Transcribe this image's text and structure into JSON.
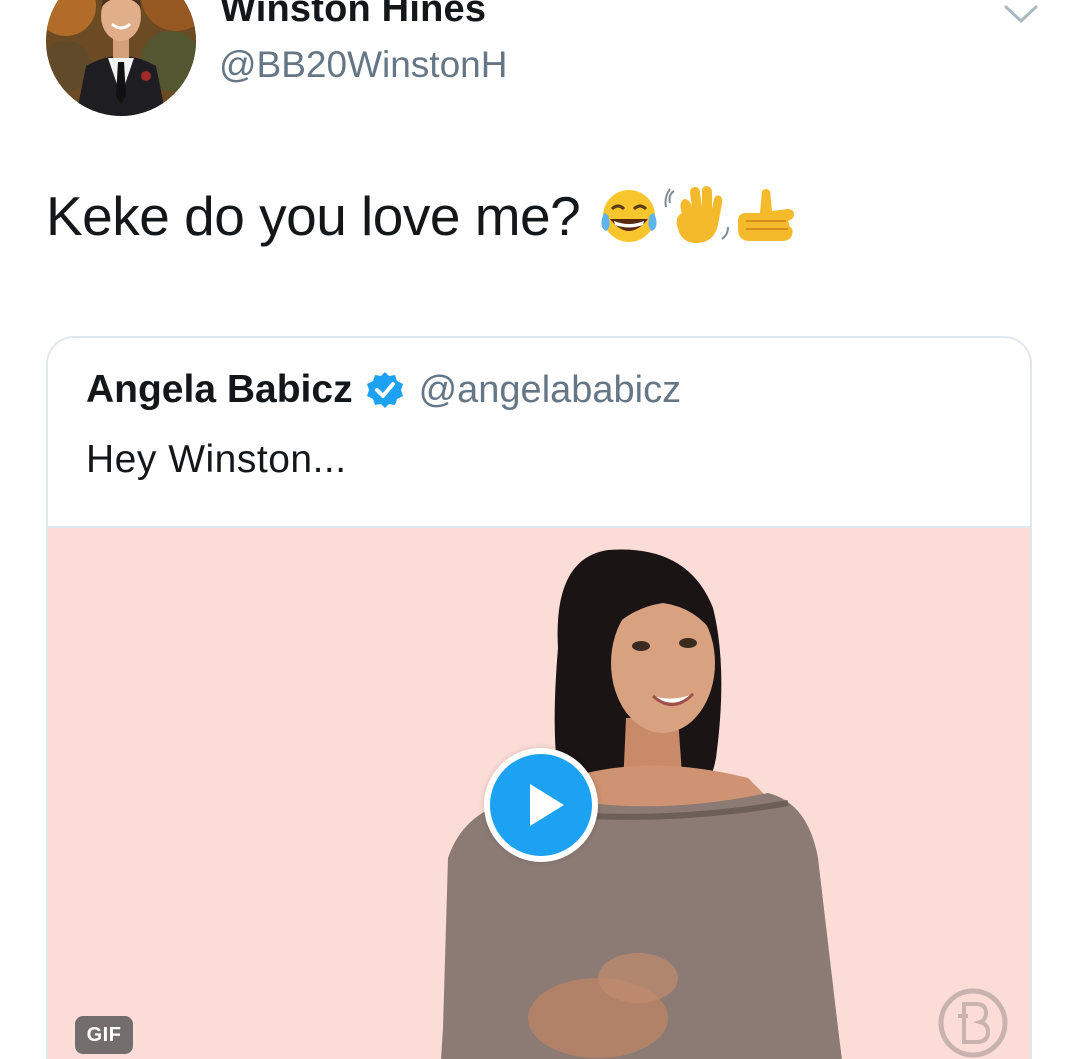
{
  "author": {
    "display_name": "Winston Hines",
    "handle": "@BB20WinstonH"
  },
  "tweet": {
    "text": "Keke do you love me?",
    "emojis": [
      "face-with-tears-of-joy-emoji",
      "waving-hand-emoji",
      "call-me-hand-emoji"
    ]
  },
  "quoted_tweet": {
    "display_name": "Angela Babicz",
    "verified": true,
    "handle": "@angelababicz",
    "text": "Hey Winston...",
    "media": {
      "type": "gif",
      "badge": "GIF",
      "background_color": "#fbdcd6"
    }
  },
  "colors": {
    "text_primary": "#14171a",
    "text_secondary": "#657786",
    "twitter_blue": "#1da1f2",
    "border": "#e1e8ed"
  }
}
